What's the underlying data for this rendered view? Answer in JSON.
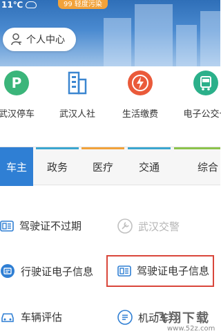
{
  "header": {
    "weather_text": "11℃",
    "air_quality": "99 轻度污染",
    "personal_center_label": "个人中心"
  },
  "services": [
    {
      "label": "武汉停车",
      "icon": "parking-icon",
      "color": "#3bb57a"
    },
    {
      "label": "武汉人社",
      "icon": "building-icon",
      "color": "#3b86d0"
    },
    {
      "label": "生活缴费",
      "icon": "lightning-icon",
      "color": "#ea5a3a"
    },
    {
      "label": "电子公交卡",
      "icon": "bus-card-icon",
      "color": "#2bb08a"
    }
  ],
  "tabs": [
    {
      "label": "车主",
      "active": true
    },
    {
      "label": "政务",
      "color": "#3aa6d0"
    },
    {
      "label": "医疗",
      "color": "#f2a23a"
    },
    {
      "label": "交通",
      "color": "#3aa6d0"
    },
    {
      "label": "综合",
      "color": "#8bc34a"
    }
  ],
  "functions": [
    {
      "label": "驾驶证不过期",
      "icon": "license-card-icon",
      "enabled": true
    },
    {
      "label": "武汉交警",
      "icon": "police-wrench-icon",
      "enabled": false
    },
    {
      "label": "行驶证电子信息",
      "icon": "vehicle-license-icon",
      "enabled": true
    },
    {
      "label": "驾驶证电子信息",
      "icon": "license-card-icon",
      "enabled": true,
      "highlighted": true
    },
    {
      "label": "车辆评估",
      "icon": "car-icon",
      "enabled": true
    },
    {
      "label": "机动车",
      "icon": "vehicle-service-icon",
      "enabled": true
    }
  ],
  "watermark": {
    "text": "飞翔下载",
    "url": "www.52z.com"
  },
  "colors": {
    "accent": "#2f7fd4",
    "highlight_border": "#d9463a"
  }
}
